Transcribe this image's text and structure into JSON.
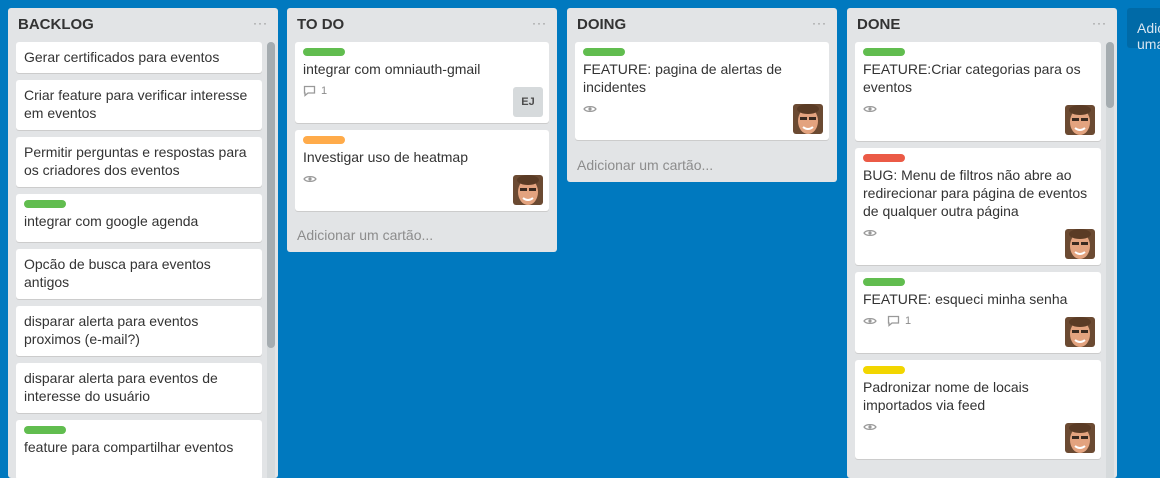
{
  "colors": {
    "board_bg": "#0079bf",
    "list_bg": "#e2e4e6",
    "label_green": "#61bd4f",
    "label_orange": "#ffab4a",
    "label_red": "#eb5a46",
    "label_yellow": "#f2d600"
  },
  "add_card_label": "Adicionar um cartão...",
  "add_list_label": "Adicionar uma lista...",
  "lists": [
    {
      "title": "BACKLOG",
      "menu": "···",
      "cards": [
        {
          "title": "Gerar certificados para eventos"
        },
        {
          "title": "Criar feature para verificar interesse em eventos"
        },
        {
          "title": "Permitir perguntas e respostas para os criadores dos eventos"
        },
        {
          "title": "integrar com google agenda",
          "label": "green"
        },
        {
          "title": "Opcão de busca para eventos antigos"
        },
        {
          "title": "disparar alerta para eventos proximos (e-mail?)"
        },
        {
          "title": "disparar alerta para eventos de interesse do usuário"
        },
        {
          "title": "feature para compartilhar eventos",
          "label": "green"
        }
      ]
    },
    {
      "title": "TO DO",
      "menu": "···",
      "cards": [
        {
          "title": "integrar com omniauth-gmail",
          "label": "green",
          "comments": "1",
          "avatar_initials": "EJ"
        },
        {
          "title": "Investigar uso de heatmap",
          "label": "orange",
          "watch": true,
          "avatar": "photo"
        }
      ]
    },
    {
      "title": "DOING",
      "menu": "···",
      "cards": [
        {
          "title": "FEATURE: pagina de alertas de incidentes",
          "label": "green",
          "watch": true,
          "avatar": "photo"
        }
      ]
    },
    {
      "title": "DONE",
      "menu": "···",
      "cards": [
        {
          "title": "FEATURE:Criar categorias para os eventos",
          "label": "green",
          "watch": true,
          "avatar": "photo"
        },
        {
          "title": "BUG: Menu de filtros não abre ao redirecionar para página de eventos de qualquer outra página",
          "label": "red",
          "watch": true,
          "avatar": "photo"
        },
        {
          "title": "FEATURE: esqueci minha senha",
          "label": "green",
          "watch": true,
          "comments": "1",
          "avatar": "photo"
        },
        {
          "title": "Padronizar nome de locais importados via feed",
          "label": "yellow",
          "watch": true,
          "avatar": "photo"
        }
      ]
    }
  ]
}
